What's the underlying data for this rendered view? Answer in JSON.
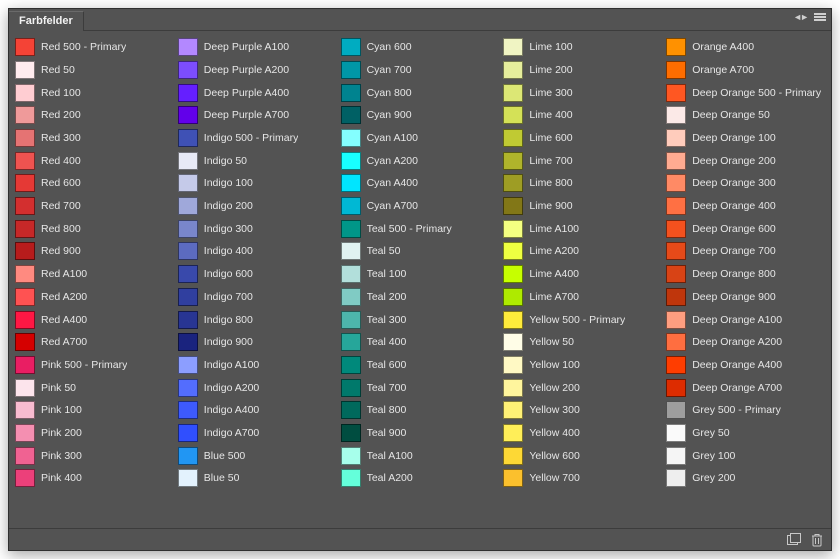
{
  "panel": {
    "title": "Farbfelder"
  },
  "columns": [
    [
      {
        "hex": "#f44336",
        "label": "Red 500 - Primary"
      },
      {
        "hex": "#ffebee",
        "label": "Red 50"
      },
      {
        "hex": "#ffcdd2",
        "label": "Red 100"
      },
      {
        "hex": "#ef9a9a",
        "label": "Red 200"
      },
      {
        "hex": "#e57373",
        "label": "Red 300"
      },
      {
        "hex": "#ef5350",
        "label": "Red 400"
      },
      {
        "hex": "#e53935",
        "label": "Red 600"
      },
      {
        "hex": "#d32f2f",
        "label": "Red 700"
      },
      {
        "hex": "#c62828",
        "label": "Red 800"
      },
      {
        "hex": "#b71c1c",
        "label": "Red 900"
      },
      {
        "hex": "#ff8a80",
        "label": "Red A100"
      },
      {
        "hex": "#ff5252",
        "label": "Red A200"
      },
      {
        "hex": "#ff1744",
        "label": "Red A400"
      },
      {
        "hex": "#d50000",
        "label": "Red A700"
      },
      {
        "hex": "#e91e63",
        "label": "Pink 500 - Primary"
      },
      {
        "hex": "#fce4ec",
        "label": "Pink 50"
      },
      {
        "hex": "#f8bbd0",
        "label": "Pink 100"
      },
      {
        "hex": "#f48fb1",
        "label": "Pink 200"
      },
      {
        "hex": "#f06292",
        "label": "Pink 300"
      },
      {
        "hex": "#ec407a",
        "label": "Pink 400"
      }
    ],
    [
      {
        "hex": "#b388ff",
        "label": "Deep Purple A100"
      },
      {
        "hex": "#7c4dff",
        "label": "Deep Purple A200"
      },
      {
        "hex": "#651fff",
        "label": "Deep Purple A400"
      },
      {
        "hex": "#6200ea",
        "label": "Deep Purple A700"
      },
      {
        "hex": "#3f51b5",
        "label": "Indigo 500 - Primary"
      },
      {
        "hex": "#e8eaf6",
        "label": "Indigo 50"
      },
      {
        "hex": "#c5cae9",
        "label": "Indigo 100"
      },
      {
        "hex": "#9fa8da",
        "label": "Indigo 200"
      },
      {
        "hex": "#7986cb",
        "label": "Indigo 300"
      },
      {
        "hex": "#5c6bc0",
        "label": "Indigo 400"
      },
      {
        "hex": "#3949ab",
        "label": "Indigo 600"
      },
      {
        "hex": "#303f9f",
        "label": "Indigo 700"
      },
      {
        "hex": "#283593",
        "label": "Indigo 800"
      },
      {
        "hex": "#1a237e",
        "label": "Indigo 900"
      },
      {
        "hex": "#8c9eff",
        "label": "Indigo A100"
      },
      {
        "hex": "#536dfe",
        "label": "Indigo A200"
      },
      {
        "hex": "#3d5afe",
        "label": "Indigo A400"
      },
      {
        "hex": "#304ffe",
        "label": "Indigo A700"
      },
      {
        "hex": "#2196f3",
        "label": "Blue 500"
      },
      {
        "hex": "#e3f2fd",
        "label": "Blue 50"
      }
    ],
    [
      {
        "hex": "#00acc1",
        "label": "Cyan 600"
      },
      {
        "hex": "#0097a7",
        "label": "Cyan 700"
      },
      {
        "hex": "#00838f",
        "label": "Cyan 800"
      },
      {
        "hex": "#006064",
        "label": "Cyan 900"
      },
      {
        "hex": "#84ffff",
        "label": "Cyan A100"
      },
      {
        "hex": "#18ffff",
        "label": "Cyan A200"
      },
      {
        "hex": "#00e5ff",
        "label": "Cyan A400"
      },
      {
        "hex": "#00b8d4",
        "label": "Cyan A700"
      },
      {
        "hex": "#009688",
        "label": "Teal 500 - Primary"
      },
      {
        "hex": "#e0f2f1",
        "label": "Teal 50"
      },
      {
        "hex": "#b2dfdb",
        "label": "Teal 100"
      },
      {
        "hex": "#80cbc4",
        "label": "Teal 200"
      },
      {
        "hex": "#4db6ac",
        "label": "Teal 300"
      },
      {
        "hex": "#26a69a",
        "label": "Teal 400"
      },
      {
        "hex": "#00897b",
        "label": "Teal 600"
      },
      {
        "hex": "#00796b",
        "label": "Teal 700"
      },
      {
        "hex": "#00695c",
        "label": "Teal 800"
      },
      {
        "hex": "#004d40",
        "label": "Teal 900"
      },
      {
        "hex": "#a7ffeb",
        "label": "Teal A100"
      },
      {
        "hex": "#64ffda",
        "label": "Teal A200"
      }
    ],
    [
      {
        "hex": "#f0f4c3",
        "label": "Lime 100"
      },
      {
        "hex": "#e6ee9c",
        "label": "Lime 200"
      },
      {
        "hex": "#dce775",
        "label": "Lime 300"
      },
      {
        "hex": "#d4e157",
        "label": "Lime 400"
      },
      {
        "hex": "#c0ca33",
        "label": "Lime 600"
      },
      {
        "hex": "#afb42b",
        "label": "Lime 700"
      },
      {
        "hex": "#9e9d24",
        "label": "Lime 800"
      },
      {
        "hex": "#827717",
        "label": "Lime 900"
      },
      {
        "hex": "#f4ff81",
        "label": "Lime A100"
      },
      {
        "hex": "#eeff41",
        "label": "Lime A200"
      },
      {
        "hex": "#c6ff00",
        "label": "Lime A400"
      },
      {
        "hex": "#aeea00",
        "label": "Lime A700"
      },
      {
        "hex": "#ffeb3b",
        "label": "Yellow 500 - Primary"
      },
      {
        "hex": "#fffde7",
        "label": "Yellow 50"
      },
      {
        "hex": "#fff9c4",
        "label": "Yellow 100"
      },
      {
        "hex": "#fff59d",
        "label": "Yellow 200"
      },
      {
        "hex": "#fff176",
        "label": "Yellow 300"
      },
      {
        "hex": "#ffee58",
        "label": "Yellow 400"
      },
      {
        "hex": "#fdd835",
        "label": "Yellow 600"
      },
      {
        "hex": "#fbc02d",
        "label": "Yellow 700"
      }
    ],
    [
      {
        "hex": "#ff9100",
        "label": "Orange A400"
      },
      {
        "hex": "#ff6d00",
        "label": "Orange A700"
      },
      {
        "hex": "#ff5722",
        "label": "Deep Orange 500 - Primary"
      },
      {
        "hex": "#fbe9e7",
        "label": "Deep Orange 50"
      },
      {
        "hex": "#ffccbc",
        "label": "Deep Orange 100"
      },
      {
        "hex": "#ffab91",
        "label": "Deep Orange 200"
      },
      {
        "hex": "#ff8a65",
        "label": "Deep Orange 300"
      },
      {
        "hex": "#ff7043",
        "label": "Deep Orange 400"
      },
      {
        "hex": "#f4511e",
        "label": "Deep Orange 600"
      },
      {
        "hex": "#e64a19",
        "label": "Deep Orange 700"
      },
      {
        "hex": "#d84315",
        "label": "Deep Orange 800"
      },
      {
        "hex": "#bf360c",
        "label": "Deep Orange 900"
      },
      {
        "hex": "#ff9e80",
        "label": "Deep Orange A100"
      },
      {
        "hex": "#ff6e40",
        "label": "Deep Orange A200"
      },
      {
        "hex": "#ff3d00",
        "label": "Deep Orange A400"
      },
      {
        "hex": "#dd2c00",
        "label": "Deep Orange A700"
      },
      {
        "hex": "#9e9e9e",
        "label": "Grey 500 - Primary"
      },
      {
        "hex": "#fafafa",
        "label": "Grey 50"
      },
      {
        "hex": "#f5f5f5",
        "label": "Grey 100"
      },
      {
        "hex": "#eeeeee",
        "label": "Grey 200"
      }
    ]
  ]
}
